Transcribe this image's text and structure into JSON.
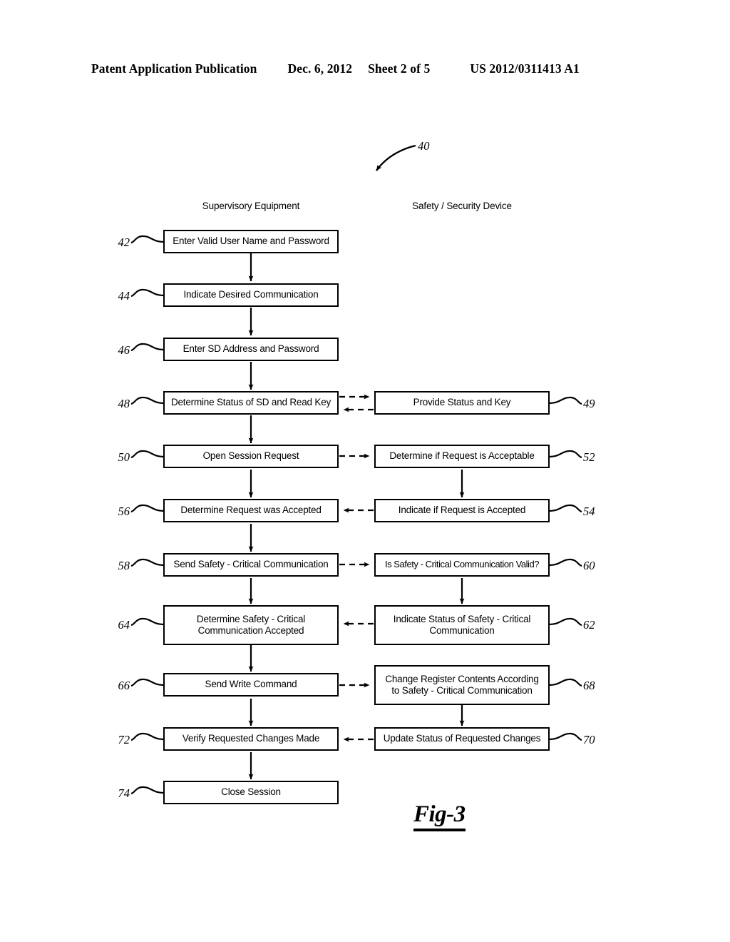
{
  "header": {
    "publication": "Patent Application Publication",
    "date": "Dec. 6, 2012",
    "sheet": "Sheet 2 of 5",
    "number": "US 2012/0311413 A1"
  },
  "figure": {
    "caption": "Fig-3",
    "lead_numeral": "40",
    "columns": {
      "left": "Supervisory Equipment",
      "right": "Safety / Security Device"
    },
    "nodes": [
      {
        "ref": "42",
        "column": "left",
        "text": "Enter Valid User Name and Password"
      },
      {
        "ref": "44",
        "column": "left",
        "text": "Indicate Desired Communication"
      },
      {
        "ref": "46",
        "column": "left",
        "text": "Enter SD Address and Password"
      },
      {
        "ref": "48",
        "column": "left",
        "text": "Determine Status of SD and Read Key"
      },
      {
        "ref": "49",
        "column": "right",
        "text": "Provide Status and Key"
      },
      {
        "ref": "50",
        "column": "left",
        "text": "Open Session Request"
      },
      {
        "ref": "52",
        "column": "right",
        "text": "Determine if Request is Acceptable"
      },
      {
        "ref": "56",
        "column": "left",
        "text": "Determine Request was Accepted"
      },
      {
        "ref": "54",
        "column": "right",
        "text": "Indicate if Request is Accepted"
      },
      {
        "ref": "58",
        "column": "left",
        "text": "Send Safety - Critical Communication"
      },
      {
        "ref": "60",
        "column": "right",
        "text": "Is Safety - Critical Communication Valid?"
      },
      {
        "ref": "64",
        "column": "left",
        "line1": "Determine Safety - Critical",
        "line2": "Communication Accepted"
      },
      {
        "ref": "62",
        "column": "right",
        "line1": "Indicate Status of Safety - Critical",
        "line2": "Communication"
      },
      {
        "ref": "66",
        "column": "left",
        "text": "Send Write Command"
      },
      {
        "ref": "68",
        "column": "right",
        "line1": "Change Register Contents According",
        "line2": "to Safety - Critical Communication"
      },
      {
        "ref": "72",
        "column": "left",
        "text": "Verify Requested Changes Made"
      },
      {
        "ref": "70",
        "column": "right",
        "text": "Update Status of Requested Changes"
      },
      {
        "ref": "74",
        "column": "left",
        "text": "Close Session"
      }
    ]
  }
}
